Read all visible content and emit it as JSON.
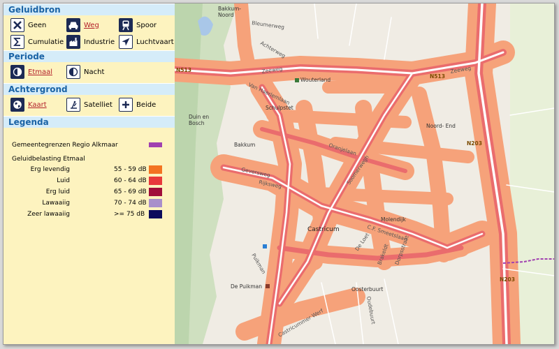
{
  "sidebar": {
    "geluidbron": {
      "title": "Geluidbron",
      "items": [
        {
          "label": "Geen",
          "icon": "x-icon",
          "active": false
        },
        {
          "label": "Weg",
          "icon": "car-icon",
          "active": true
        },
        {
          "label": "Spoor",
          "icon": "train-icon",
          "active": false
        },
        {
          "label": "Cumulatie",
          "icon": "sigma-icon",
          "active": false
        },
        {
          "label": "Industrie",
          "icon": "factory-icon",
          "active": false
        },
        {
          "label": "Luchtvaart",
          "icon": "airplane-icon",
          "active": false
        }
      ]
    },
    "periode": {
      "title": "Periode",
      "items": [
        {
          "label": "Etmaal",
          "icon": "half-moon-icon",
          "active": true
        },
        {
          "label": "Nacht",
          "icon": "half-circle-icon",
          "active": false
        }
      ]
    },
    "achtergrond": {
      "title": "Achtergrond",
      "items": [
        {
          "label": "Kaart",
          "icon": "globe-icon",
          "active": true
        },
        {
          "label": "Satelliet",
          "icon": "satellite-icon",
          "active": false
        },
        {
          "label": "Beide",
          "icon": "plus-icon",
          "active": false
        }
      ]
    },
    "legenda": {
      "title": "Legenda",
      "boundary_label": "Gemeentegrenzen Regio Alkmaar",
      "boundary_color": "#a040b0",
      "subtitle": "Geluidbelasting Etmaal",
      "classes": [
        {
          "name": "Erg levendig",
          "range": "55 - 59 dB",
          "color": "#f37321"
        },
        {
          "name": "Luid",
          "range": "60 - 64 dB",
          "color": "#e8393b"
        },
        {
          "name": "Erg luid",
          "range": "65 - 69 dB",
          "color": "#a10e3a"
        },
        {
          "name": "Lawaaiig",
          "range": "70 - 74 dB",
          "color": "#a98fcb"
        },
        {
          "name": "Zeer lawaaiig",
          "range": ">= 75 dB",
          "color": "#0c0c5c"
        }
      ]
    }
  },
  "map": {
    "labels": {
      "bakkum_noord": "Bakkum-\nNoord",
      "bleumerweg": "Bleumerweg",
      "achterweg": "Achterweg",
      "n513_left": "N513",
      "zeeweg": "Zeeweg",
      "wouterland": "Wouterland",
      "n513_right": "N513",
      "zeeweg_right": "Zeeweg",
      "van_haerlemlaan": "Van Haerlemlaan",
      "schulpstet": "Schulpstet",
      "duin_en_bosch": "Duin en\nBosch",
      "noord_end": "Noord- End",
      "bakkum": "Bakkum",
      "oranjelaan": "Oranjelaan",
      "n203_top": "N203",
      "geversweg": "Geversweg",
      "rijksweg": "Rijksweg",
      "molendijk": "Molendijk",
      "castricum": "Castricum",
      "puikman": "Puikman",
      "de_puikman": "De Puikman",
      "oosterbuurt": "Oosterbuurt",
      "n203_bottom": "N203",
      "soomerwegh": "Soomerwegh",
      "de_loet": "De Loet",
      "brakeldt": "Brakeldt",
      "dorpsstraat": "Dorpsstraat",
      "cf_smeetslaan": "C.F. Smeetslaan",
      "oudebuurt": "Oudebuurt",
      "castricummer_werf": "Castricummer Werf"
    }
  }
}
